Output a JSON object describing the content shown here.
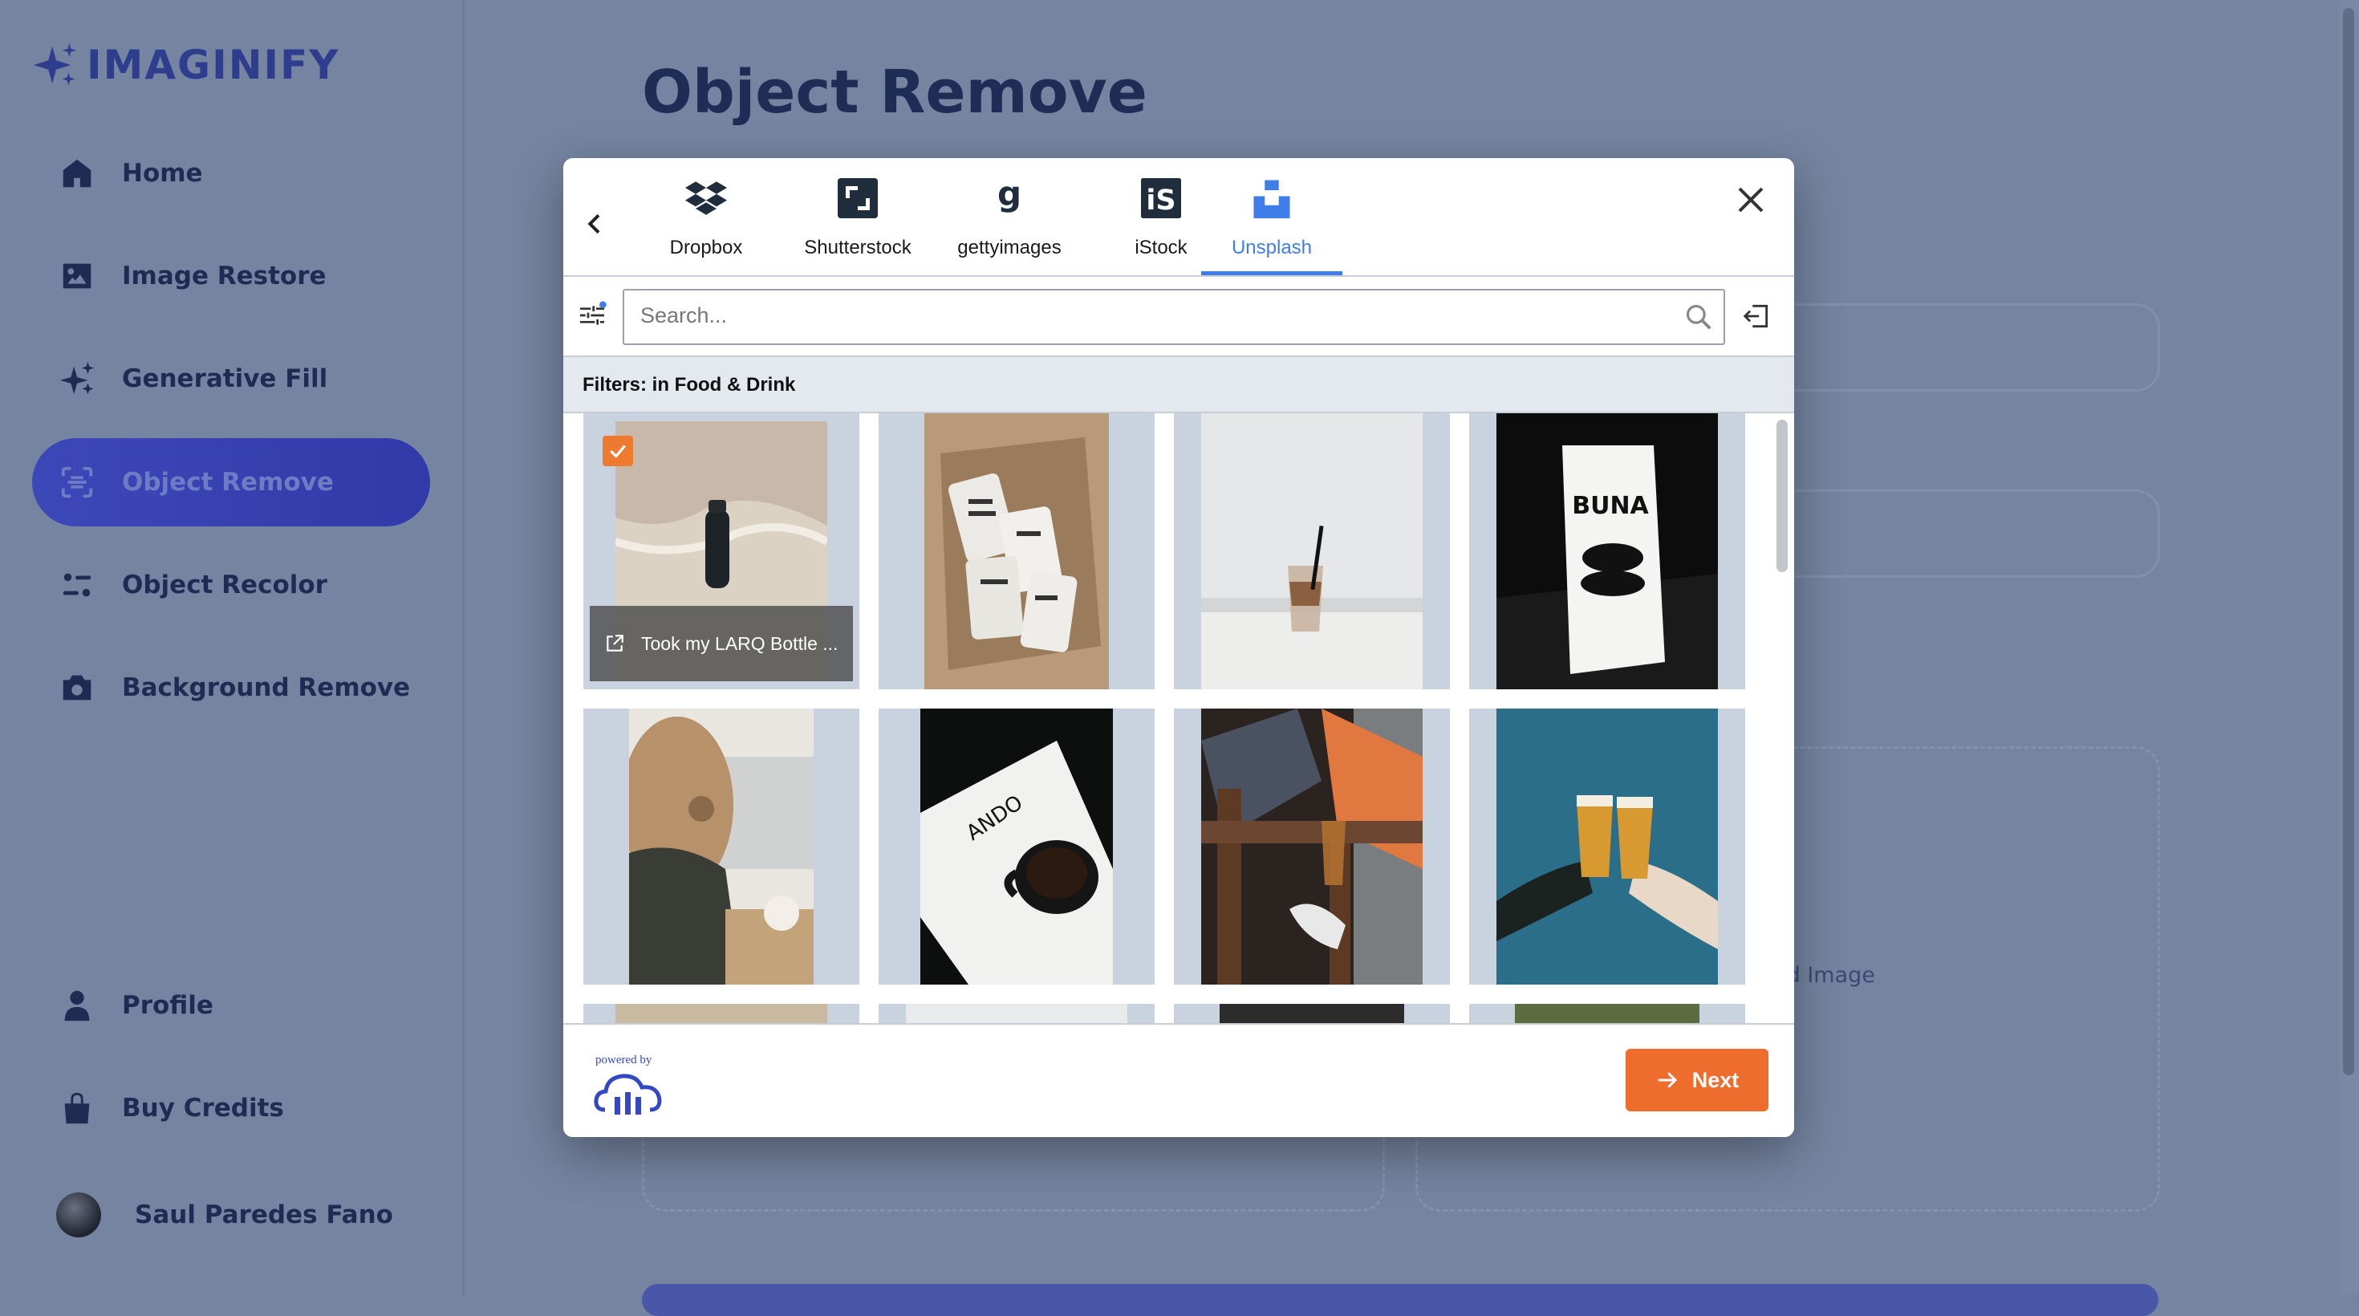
{
  "app": {
    "name": "IMAGINIFY"
  },
  "sidebar": {
    "items": [
      {
        "label": "Home",
        "icon": "home-icon"
      },
      {
        "label": "Image Restore",
        "icon": "image-icon"
      },
      {
        "label": "Generative Fill",
        "icon": "stars-icon"
      },
      {
        "label": "Object Remove",
        "icon": "scan-icon",
        "active": true
      },
      {
        "label": "Object Recolor",
        "icon": "filter-icon"
      },
      {
        "label": "Background Remove",
        "icon": "camera-icon"
      }
    ],
    "bottom_items": [
      {
        "label": "Profile",
        "icon": "user-icon"
      },
      {
        "label": "Buy Credits",
        "icon": "bag-icon"
      }
    ],
    "user": {
      "name": "Saul Paredes Fano"
    }
  },
  "main": {
    "title": "Object Remove",
    "transformed_label": "ed Image"
  },
  "widget": {
    "tabs": [
      {
        "label": "Dropbox",
        "icon": "dropbox-icon"
      },
      {
        "label": "Shutterstock",
        "icon": "shutterstock-icon"
      },
      {
        "label": "gettyimages",
        "icon": "gettyimages-icon"
      },
      {
        "label": "iStock",
        "icon": "istock-icon"
      },
      {
        "label": "Unsplash",
        "icon": "unsplash-icon",
        "active": true
      }
    ],
    "search": {
      "placeholder": "Search...",
      "value": ""
    },
    "filters_text": "Filters:  in Food & Drink",
    "photos": [
      {
        "caption": "Took my LARQ Bottle ...",
        "selected": true,
        "alt": "Black water bottle on wet sand"
      },
      {
        "alt": "Cans of oat nitro white coffee in a box"
      },
      {
        "alt": "Iced coffee in a plastic cup on table"
      },
      {
        "alt": "BUNA coffee bag"
      },
      {
        "alt": "Woman with coffee cup at laptop"
      },
      {
        "alt": "Cup of black coffee on ANDO book"
      },
      {
        "alt": "Person holding iced coffee on stool"
      },
      {
        "alt": "Two hands toasting beers"
      }
    ],
    "footer": {
      "powered_by": "powered by",
      "next_label": "Next"
    },
    "accent": "#3f7ee8",
    "action_color": "#ee6d2d"
  }
}
